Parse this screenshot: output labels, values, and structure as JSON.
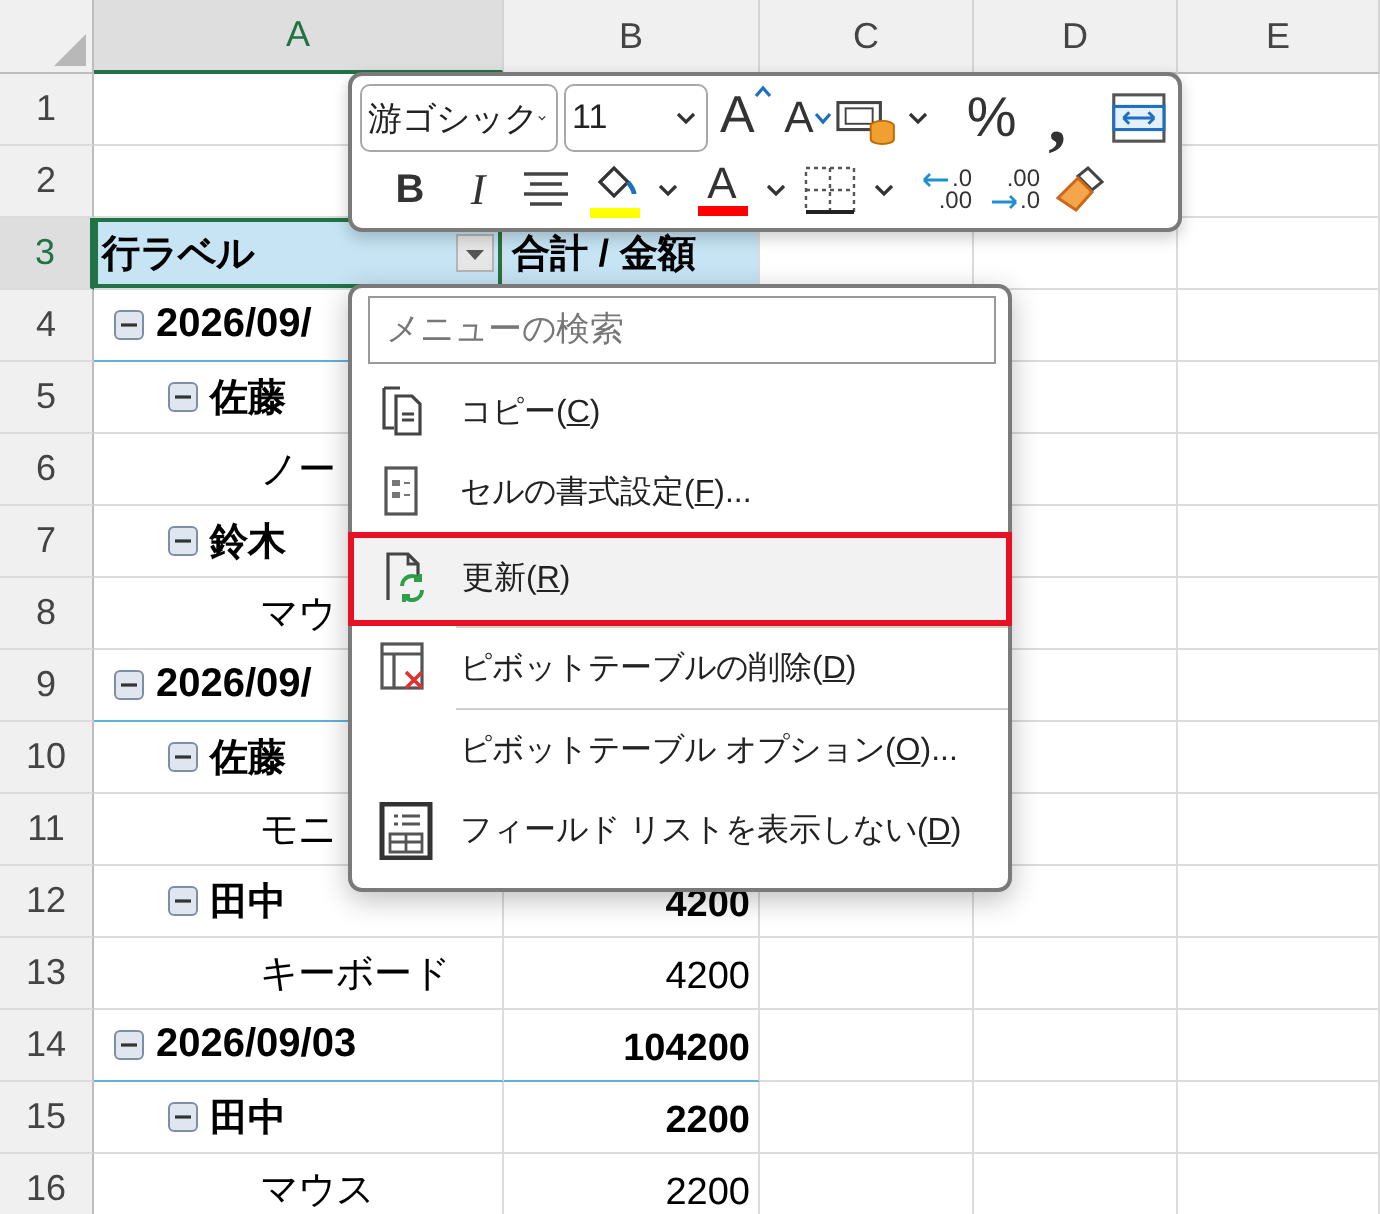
{
  "columns": [
    {
      "label": "A",
      "selected": true
    },
    {
      "label": "B",
      "selected": false
    },
    {
      "label": "C",
      "selected": false
    },
    {
      "label": "D",
      "selected": false
    },
    {
      "label": "E",
      "selected": false
    }
  ],
  "rows": [
    {
      "number": "1",
      "selected": false,
      "kind": "empty"
    },
    {
      "number": "2",
      "selected": false,
      "kind": "empty"
    },
    {
      "number": "3",
      "selected": true,
      "kind": "header",
      "label": "行ラベル",
      "value": "合計 / 金額"
    },
    {
      "number": "4",
      "selected": false,
      "kind": "date",
      "label": "2026/09/"
    },
    {
      "number": "5",
      "selected": false,
      "kind": "person",
      "label": "佐藤"
    },
    {
      "number": "6",
      "selected": false,
      "kind": "item",
      "label": "ノー"
    },
    {
      "number": "7",
      "selected": false,
      "kind": "person",
      "label": "鈴木"
    },
    {
      "number": "8",
      "selected": false,
      "kind": "item",
      "label": "マウ"
    },
    {
      "number": "9",
      "selected": false,
      "kind": "date",
      "label": "2026/09/"
    },
    {
      "number": "10",
      "selected": false,
      "kind": "person",
      "label": "佐藤"
    },
    {
      "number": "11",
      "selected": false,
      "kind": "item",
      "label": "モニ"
    },
    {
      "number": "12",
      "selected": false,
      "kind": "person",
      "label": "田中",
      "value": "4200"
    },
    {
      "number": "13",
      "selected": false,
      "kind": "item",
      "label": "キーボード",
      "value": "4200"
    },
    {
      "number": "14",
      "selected": false,
      "kind": "date",
      "label": "2026/09/03",
      "value": "104200"
    },
    {
      "number": "15",
      "selected": false,
      "kind": "person",
      "label": "田中",
      "value": "2200"
    },
    {
      "number": "16",
      "selected": false,
      "kind": "item",
      "label": "マウス",
      "value": "2200"
    }
  ],
  "mini_toolbar": {
    "row_1": [
      {
        "kind": "font-select",
        "value": "游ゴシック"
      },
      {
        "kind": "size-select",
        "value": "11"
      },
      {
        "kind": "grow-font",
        "glyph": "A"
      },
      {
        "kind": "shrink-font",
        "glyph": "A"
      },
      {
        "kind": "cell-styles"
      },
      {
        "kind": "dropdown"
      },
      {
        "kind": "percent",
        "glyph": "%"
      },
      {
        "kind": "comma",
        "glyph": ","
      },
      {
        "kind": "merge"
      }
    ],
    "row_2": [
      {
        "kind": "bold",
        "glyph": "B"
      },
      {
        "kind": "italic",
        "glyph": "I"
      },
      {
        "kind": "align"
      },
      {
        "kind": "fill-color",
        "color": "#ffff00"
      },
      {
        "kind": "dropdown"
      },
      {
        "kind": "font-color",
        "glyph": "A",
        "color": "#ff0000"
      },
      {
        "kind": "dropdown"
      },
      {
        "kind": "borders"
      },
      {
        "kind": "dropdown"
      },
      {
        "kind": "decimal-increase",
        "top": ".0",
        "bottom": ".00"
      },
      {
        "kind": "decimal-decrease",
        "top": ".00",
        "bottom": ".0"
      },
      {
        "kind": "format-painter"
      }
    ]
  },
  "context_menu": {
    "search": {
      "placeholder": "メニューの検索"
    },
    "items": [
      {
        "kind": "copy",
        "before": "コピー(",
        "key": "C",
        "after": ")",
        "highlighted": false,
        "separator_after": false
      },
      {
        "kind": "format",
        "before": "セルの書式設定(",
        "key": "F",
        "after": ")...",
        "highlighted": false,
        "separator_after": false
      },
      {
        "kind": "refresh",
        "before": "更新(",
        "key": "R",
        "after": ")",
        "highlighted": true,
        "separator_after": true
      },
      {
        "kind": "delete",
        "before": "ピボットテーブルの削除(",
        "key": "D",
        "after": ")",
        "highlighted": false,
        "separator_after": true
      },
      {
        "kind": "plain",
        "before": "ピボットテーブル オプション(",
        "key": "O",
        "after": ")...",
        "highlighted": false,
        "separator_after": false
      },
      {
        "kind": "field-list",
        "before": "フィールド リストを表示しない(",
        "key": "D",
        "after": ")",
        "highlighted": false,
        "separator_after": false
      }
    ]
  }
}
